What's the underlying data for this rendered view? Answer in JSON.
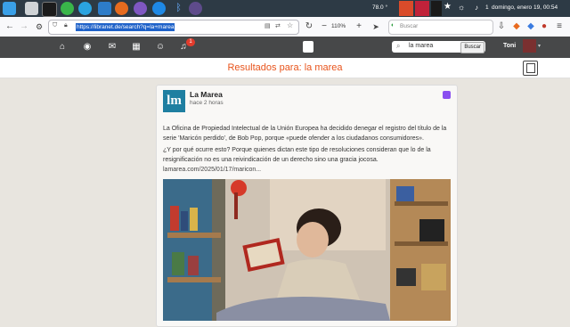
{
  "taskbar": {
    "temperature": "78.0 °",
    "workspace": "1",
    "clock": "domingo, enero 19, 00:54"
  },
  "browser": {
    "url": "https://libranet.de/search?q=la+marea",
    "zoom": "110%",
    "search_placeholder": "Buscar"
  },
  "site": {
    "notification_count": "1",
    "search_value": "la marea",
    "search_button": "Buscar",
    "username": "Toni"
  },
  "results": {
    "title": "Resultados para: la marea"
  },
  "post": {
    "avatar_text": "lm",
    "author": "La Marea",
    "time": "hace 2 horas",
    "paragraph1": "La Oficina de Propiedad Intelectual de la Unión Europea ha decidido denegar el registro del título de la serie 'Maricón perdido', de Bob Pop, porque «puede ofender a los ciudadanos consumidores».",
    "paragraph2": "¿Y por qué ocurre esto? Porque quienes dictan este tipo de resoluciones consideran que lo de la resignificación no es una reivindicación de un derecho sino una gracia jocosa.",
    "link": "lamarea.com/2025/01/17/maricon..."
  },
  "colors": {
    "accent": "#e8541c",
    "header": "#474849",
    "taskbar": "#2d3a45"
  }
}
